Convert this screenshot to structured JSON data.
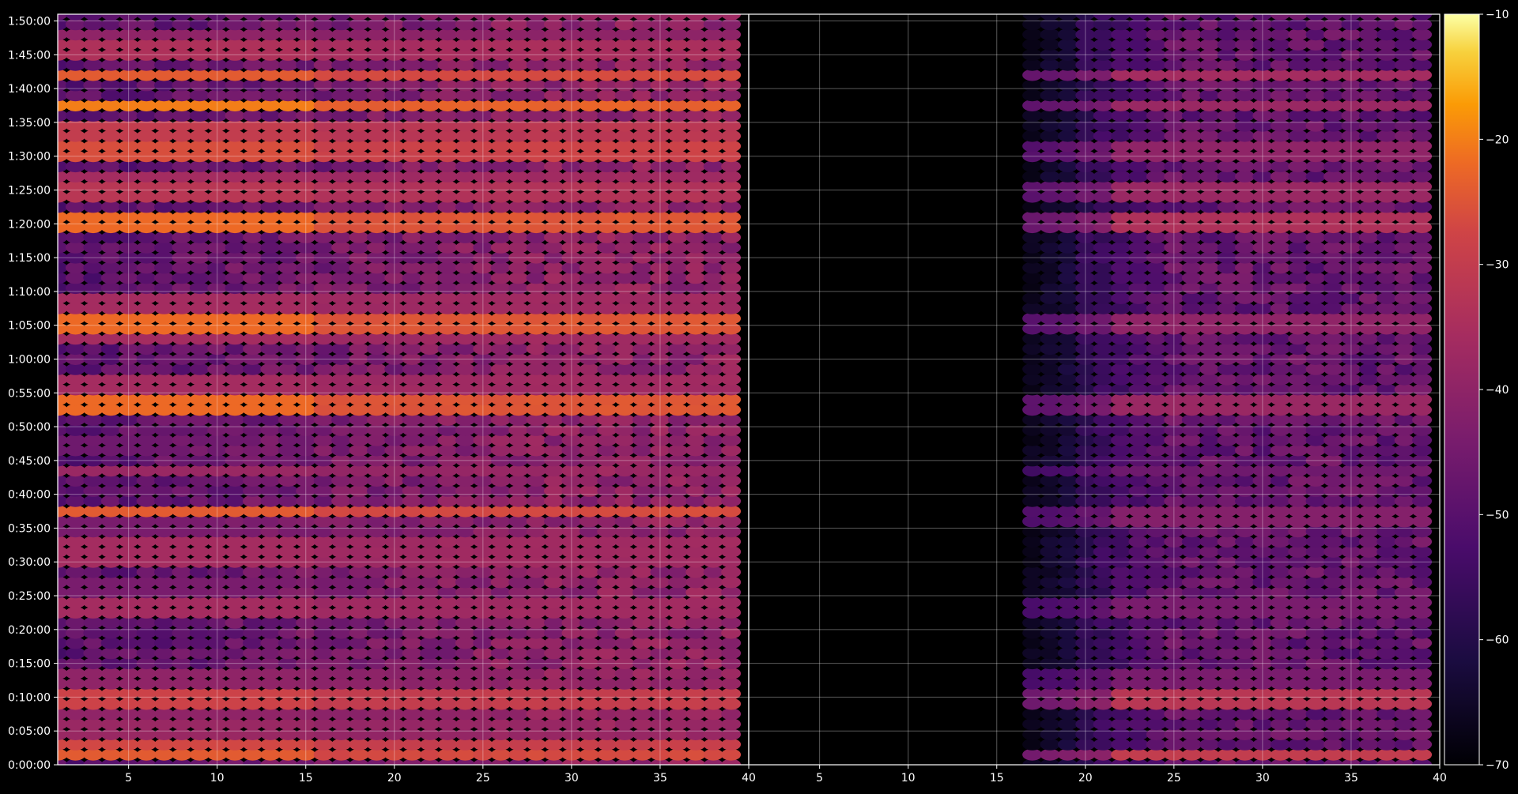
{
  "chart_data": {
    "type": "heatmap",
    "title": "",
    "xlabel": "",
    "ylabel": "",
    "grid": true,
    "colormap": "inferno",
    "background": "#000000",
    "colorbar": {
      "range": [
        -70,
        -10
      ],
      "ticks": [
        -10,
        -20,
        -30,
        -40,
        -50,
        -60,
        -70
      ],
      "tick_labels": [
        "−10",
        "−20",
        "−30",
        "−40",
        "−50",
        "−60",
        "−70"
      ]
    },
    "y_axis": {
      "range_seconds": [
        0,
        6660
      ],
      "ticks_seconds": [
        0,
        300,
        600,
        900,
        1200,
        1500,
        1800,
        2100,
        2400,
        2700,
        3000,
        3300,
        3600,
        3900,
        4200,
        4500,
        4800,
        5100,
        5400,
        5700,
        6000,
        6300,
        6600
      ],
      "tick_labels": [
        "0:00:00",
        "0:05:00",
        "0:10:00",
        "0:15:00",
        "0:20:00",
        "0:25:00",
        "0:30:00",
        "0:35:00",
        "0:40:00",
        "0:45:00",
        "0:50:00",
        "0:55:00",
        "1:00:00",
        "1:05:00",
        "1:10:00",
        "1:15:00",
        "1:20:00",
        "1:25:00",
        "1:30:00",
        "1:35:00",
        "1:40:00",
        "1:45:00",
        "1:50:00"
      ]
    },
    "panels": [
      {
        "name": "left",
        "x_range": [
          1,
          40
        ],
        "x_ticks": [
          5,
          10,
          15,
          20,
          25,
          30,
          35,
          40
        ],
        "x_tick_labels": [
          "5",
          "10",
          "15",
          "20",
          "25",
          "30",
          "35",
          "40"
        ],
        "bins": {
          "x_start": 1,
          "x_end": 39,
          "x_step": 1,
          "y_step_seconds": 90
        },
        "approx_levels": "strong across all x (−45 to −20), strongest at x<15 on bright rows",
        "bright_rows": [
          {
            "time": "0:01:30",
            "level": -24
          },
          {
            "time": "0:02:45",
            "level": -27
          },
          {
            "time": "0:05:30",
            "level": -38
          },
          {
            "time": "0:07:30",
            "level": -40
          },
          {
            "time": "0:10:00",
            "level": -28
          },
          {
            "time": "0:12:30",
            "level": -40
          },
          {
            "time": "0:23:00",
            "level": -36
          },
          {
            "time": "0:26:30",
            "level": -44
          },
          {
            "time": "0:31:00",
            "level": -36
          },
          {
            "time": "0:32:30",
            "level": -36
          },
          {
            "time": "0:35:00",
            "level": -44
          },
          {
            "time": "0:37:00",
            "level": -24
          },
          {
            "time": "0:43:30",
            "level": -38
          },
          {
            "time": "0:47:00",
            "level": -46
          },
          {
            "time": "0:53:00",
            "level": -22
          },
          {
            "time": "0:56:30",
            "level": -36
          },
          {
            "time": "1:03:00",
            "level": -36
          },
          {
            "time": "1:05:00",
            "level": -22
          },
          {
            "time": "1:08:00",
            "level": -36
          },
          {
            "time": "1:20:00",
            "level": -22
          },
          {
            "time": "1:25:00",
            "level": -32
          },
          {
            "time": "1:27:00",
            "level": -36
          },
          {
            "time": "1:31:00",
            "level": -26
          },
          {
            "time": "1:33:30",
            "level": -30
          },
          {
            "time": "1:37:30",
            "level": -20
          },
          {
            "time": "1:42:00",
            "level": -24
          },
          {
            "time": "1:45:30",
            "level": -34
          },
          {
            "time": "1:47:30",
            "level": -40
          }
        ]
      },
      {
        "name": "right",
        "x_range": [
          1,
          40
        ],
        "x_ticks": [
          5,
          10,
          15,
          20,
          25,
          30,
          35,
          40
        ],
        "x_tick_labels": [
          "5",
          "10",
          "15",
          "20",
          "25",
          "30",
          "35",
          "40"
        ],
        "bins": {
          "x_start": 17,
          "x_end": 39,
          "x_step": 1,
          "y_step_seconds": 90
        },
        "approx_levels": "near −70 for x<17, rising to −50…−30 for x≥25; same bright rows as left panel, weaker",
        "bright_rows": [
          {
            "time": "0:01:30",
            "level": -30
          },
          {
            "time": "0:10:00",
            "level": -32
          },
          {
            "time": "0:12:30",
            "level": -44
          },
          {
            "time": "0:23:00",
            "level": -44
          },
          {
            "time": "0:37:00",
            "level": -42
          },
          {
            "time": "0:43:30",
            "level": -46
          },
          {
            "time": "0:53:00",
            "level": -38
          },
          {
            "time": "1:05:00",
            "level": -40
          },
          {
            "time": "1:20:00",
            "level": -34
          },
          {
            "time": "1:25:00",
            "level": -38
          },
          {
            "time": "1:31:00",
            "level": -40
          },
          {
            "time": "1:37:30",
            "level": -38
          },
          {
            "time": "1:42:00",
            "level": -36
          }
        ]
      }
    ]
  }
}
